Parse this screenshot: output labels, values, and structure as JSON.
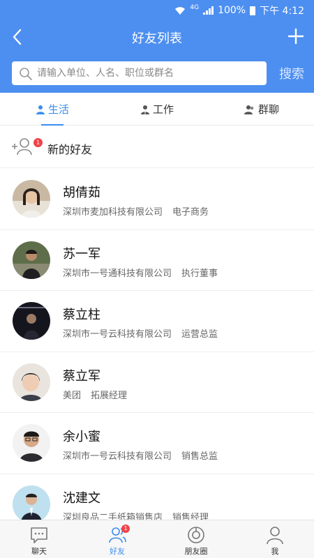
{
  "status": {
    "network": "4G",
    "battery": "100%",
    "time": "下午 4:12"
  },
  "nav": {
    "title": "好友列表"
  },
  "search": {
    "placeholder": "请输入单位、人名、职位或群名",
    "button_label": "搜索"
  },
  "tabs": [
    {
      "label": "生活",
      "icon": "person-icon",
      "active": true
    },
    {
      "label": "工作",
      "icon": "worker-icon",
      "active": false
    },
    {
      "label": "群聊",
      "icon": "group-chat-icon",
      "active": false
    }
  ],
  "new_friends": {
    "label": "新的好友",
    "badge": "1"
  },
  "friends": [
    {
      "name": "胡倩茹",
      "company": "深圳市麦加科技有限公司",
      "position": "电子商务"
    },
    {
      "name": "苏一军",
      "company": "深圳市一号通科技有限公司",
      "position": "执行董事"
    },
    {
      "name": "蔡立柱",
      "company": "深圳市一号云科技有限公司",
      "position": "运营总监"
    },
    {
      "name": "蔡立军",
      "company": "美团",
      "position": "拓展经理"
    },
    {
      "name": "余小蜜",
      "company": "深圳市一号云科技有限公司",
      "position": "销售总监"
    },
    {
      "name": "沈建文",
      "company": "深圳良品二手纸箱销售店",
      "position": "销售经理"
    }
  ],
  "bottom_tabs": [
    {
      "label": "聊天",
      "icon": "chat-icon",
      "active": false
    },
    {
      "label": "好友",
      "icon": "friends-icon",
      "active": true,
      "badge": "1"
    },
    {
      "label": "朋友圈",
      "icon": "moments-icon",
      "active": false
    },
    {
      "label": "我",
      "icon": "profile-icon",
      "active": false
    }
  ],
  "colors": {
    "primary": "#4d8ff0",
    "accent": "#3b8cf0",
    "badge": "#f0424a"
  }
}
